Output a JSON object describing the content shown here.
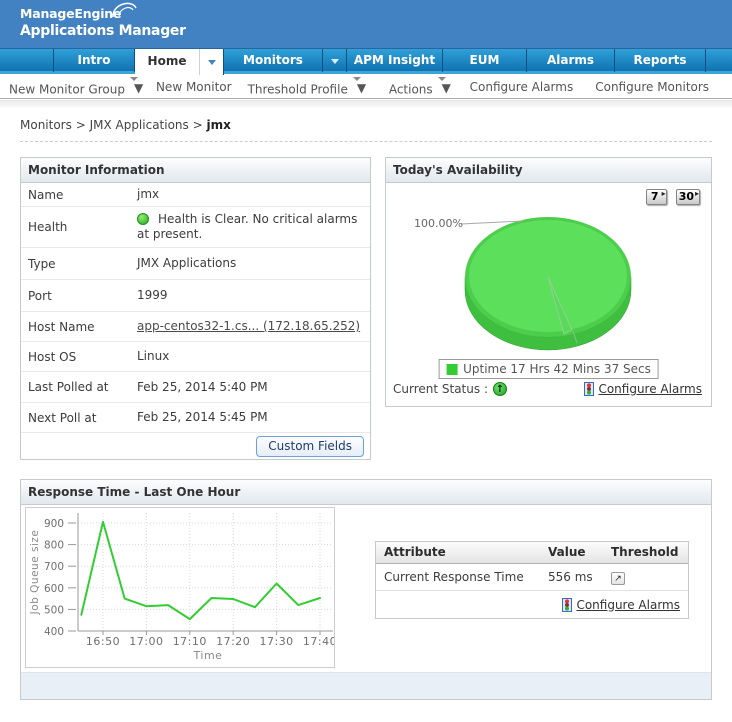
{
  "header": {
    "brand_line1": "ManageEngine",
    "brand_line2": "Applications Manager"
  },
  "nav": {
    "tabs": [
      {
        "label": "Intro",
        "active": false,
        "arrow": false
      },
      {
        "label": "Home",
        "active": true,
        "arrow": true
      },
      {
        "label": "Monitors",
        "active": false,
        "arrow": true
      },
      {
        "label": "APM Insight",
        "active": false,
        "arrow": false
      },
      {
        "label": "EUM",
        "active": false,
        "arrow": false
      },
      {
        "label": "Alarms",
        "active": false,
        "arrow": false
      },
      {
        "label": "Reports",
        "active": false,
        "arrow": false
      }
    ]
  },
  "toolbar": {
    "items": [
      {
        "label": "New Monitor Group",
        "caret": true
      },
      {
        "label": "New Monitor",
        "caret": false
      },
      {
        "label": "Threshold Profile",
        "caret": true
      },
      {
        "label": "Actions",
        "caret": true
      },
      {
        "label": "Configure Alarms",
        "caret": false
      },
      {
        "label": "Configure Monitors",
        "caret": false
      }
    ]
  },
  "breadcrumb": {
    "parts": [
      "Monitors",
      "JMX Applications"
    ],
    "current": "jmx",
    "separator": ">"
  },
  "monitor_info": {
    "title": "Monitor Information",
    "rows": [
      {
        "label": "Name",
        "value": "jmx",
        "icon": false,
        "link": false
      },
      {
        "label": "Health",
        "value": "Health is Clear. No critical alarms at present.",
        "icon": true,
        "link": false
      },
      {
        "label": "Type",
        "value": "JMX Applications",
        "icon": false,
        "link": false
      },
      {
        "label": "Port",
        "value": "1999",
        "icon": false,
        "link": false
      },
      {
        "label": "Host Name",
        "value": "app-centos32-1.cs... (172.18.65.252)",
        "icon": false,
        "link": true
      },
      {
        "label": "Host OS",
        "value": "Linux",
        "icon": false,
        "link": false
      },
      {
        "label": "Last Polled at",
        "value": "Feb 25, 2014 5:40 PM",
        "icon": false,
        "link": false
      },
      {
        "label": "Next Poll at",
        "value": "Feb 25, 2014 5:45 PM",
        "icon": false,
        "link": false
      }
    ],
    "button_label": "Custom Fields"
  },
  "availability": {
    "title": "Today's Availability",
    "range_buttons": [
      "7",
      "30"
    ],
    "current_status_label": "Current Status :",
    "configure_alarms_label": "Configure Alarms"
  },
  "response_time": {
    "title": "Response Time - Last One Hour",
    "table": {
      "headers": [
        "Attribute",
        "Value",
        "Threshold"
      ],
      "rows": [
        {
          "attribute": "Current Response Time",
          "value": "556 ms"
        }
      ],
      "configure_alarms_label": "Configure Alarms"
    }
  },
  "chart_data": [
    {
      "type": "pie",
      "title": "Today's Availability",
      "values": [
        100.0
      ],
      "labels": [
        "Uptime 17 Hrs 42 Mins 37 Secs"
      ],
      "data_label": "100.00%",
      "colors": [
        "#33cc33"
      ],
      "legend_position": "bottom"
    },
    {
      "type": "line",
      "title": "Response Time - Last One Hour",
      "x": [
        "16:45",
        "16:50",
        "16:55",
        "17:00",
        "17:05",
        "17:10",
        "17:15",
        "17:20",
        "17:25",
        "17:30",
        "17:35",
        "17:40"
      ],
      "values": [
        475,
        905,
        550,
        515,
        520,
        455,
        553,
        548,
        510,
        620,
        520,
        553
      ],
      "xlabel": "Time",
      "ylabel": "Job Queue size",
      "ylim": [
        400,
        900
      ],
      "yticks": [
        400,
        500,
        600,
        700,
        800,
        900
      ],
      "xticks": [
        "16:50",
        "17:00",
        "17:10",
        "17:20",
        "17:30",
        "17:40"
      ],
      "grid": true,
      "line_color": "#33cc33"
    }
  ]
}
